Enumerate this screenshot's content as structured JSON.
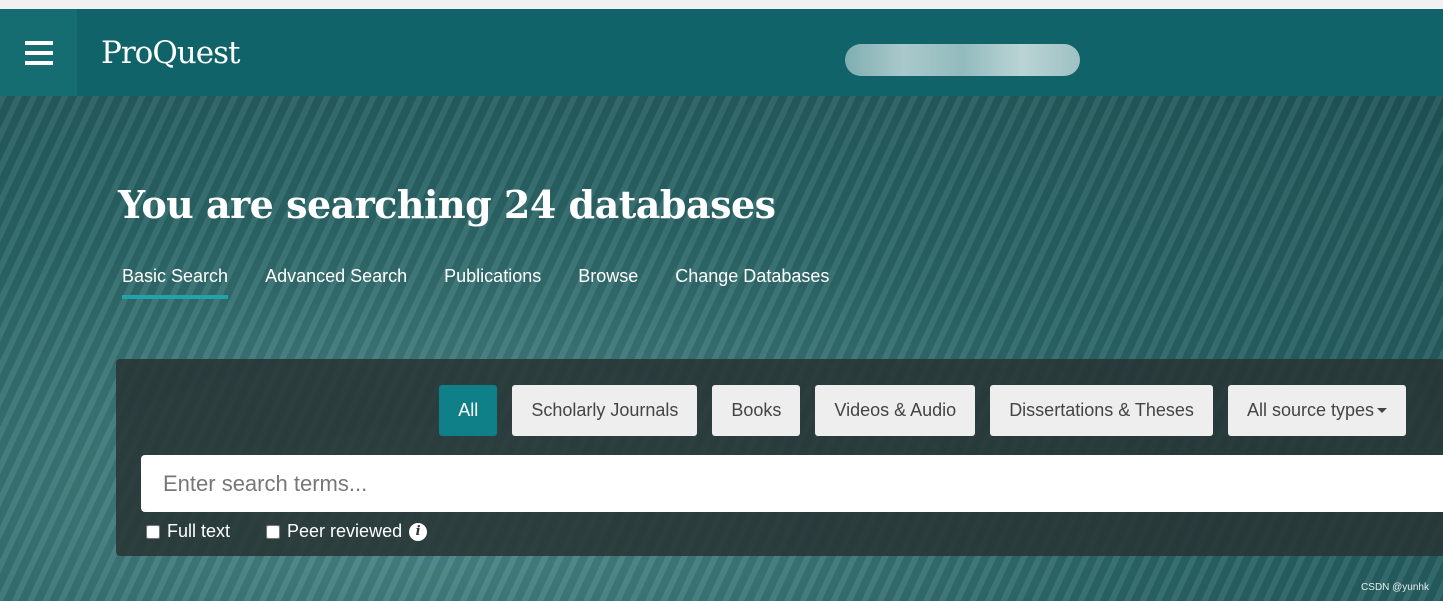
{
  "header": {
    "logo": "ProQuest"
  },
  "hero": {
    "title_prefix": "You are searching ",
    "title_bold": "24 databases"
  },
  "tabs": [
    {
      "label": "Basic Search",
      "active": true
    },
    {
      "label": "Advanced Search"
    },
    {
      "label": "Publications"
    },
    {
      "label": "Browse"
    },
    {
      "label": "Change Databases"
    }
  ],
  "filters": [
    {
      "label": "All",
      "active": true
    },
    {
      "label": "Scholarly Journals"
    },
    {
      "label": "Books"
    },
    {
      "label": "Videos & Audio"
    },
    {
      "label": "Dissertations & Theses"
    },
    {
      "label": "All source types"
    }
  ],
  "search": {
    "placeholder": "Enter search terms...",
    "value": ""
  },
  "options": {
    "full_text": "Full text",
    "peer_reviewed": "Peer reviewed",
    "info_glyph": "i"
  },
  "watermark": "CSDN @yunhk",
  "colors": {
    "header": "#106469",
    "accent": "#108088"
  }
}
